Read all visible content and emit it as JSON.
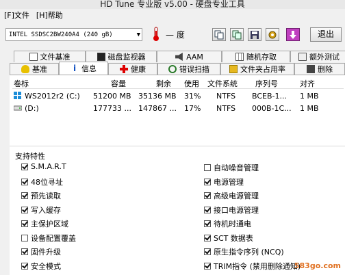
{
  "window": {
    "title": "HD Tune 专业版 v5.00 - 硬盘专业工具"
  },
  "menu": {
    "file": "[F]文件",
    "help": "[H]帮助"
  },
  "toolbar": {
    "drive": "INTEL SSDSC2BW240A4 (240 gB)",
    "temperature": "— 度",
    "exit_label": "退出"
  },
  "tabs_row1": [
    {
      "label": "文件基准"
    },
    {
      "label": "磁盘监视器"
    },
    {
      "label": "AAM"
    },
    {
      "label": "随机存取"
    },
    {
      "label": "额外测试"
    }
  ],
  "tabs_row2": [
    {
      "label": "基准"
    },
    {
      "label": "信息"
    },
    {
      "label": "健康"
    },
    {
      "label": "错误扫描"
    },
    {
      "label": "文件夹占用率"
    },
    {
      "label": "删除"
    }
  ],
  "table": {
    "headers": {
      "volume": "卷标",
      "capacity": "容量",
      "free": "剩余",
      "usage": "使用",
      "fs": "文件系统",
      "serial": "序列号",
      "align": "对齐"
    },
    "rows": [
      {
        "volume": "WS2012r2 (C:)",
        "capacity": "51200 MB",
        "free": "35136 MB",
        "usage": "31%",
        "fs": "NTFS",
        "serial": "BCEB-1...",
        "align": "1 MB"
      },
      {
        "volume": "(D:)",
        "capacity": "177733 ...",
        "free": "147867 ...",
        "usage": "17%",
        "fs": "NTFS",
        "serial": "000B-1C...",
        "align": "1 MB"
      }
    ]
  },
  "features": {
    "title": "支持特性",
    "left": [
      {
        "label": "S.M.A.R.T",
        "checked": true
      },
      {
        "label": "48位寻址",
        "checked": true
      },
      {
        "label": "预先读取",
        "checked": true
      },
      {
        "label": "写入缓存",
        "checked": true
      },
      {
        "label": "主保护区域",
        "checked": true
      },
      {
        "label": "设备配置覆盖",
        "checked": false
      },
      {
        "label": "固件升级",
        "checked": true
      },
      {
        "label": "安全模式",
        "checked": true
      }
    ],
    "right": [
      {
        "label": "自动噪音管理",
        "checked": false
      },
      {
        "label": "电源管理",
        "checked": true
      },
      {
        "label": "高级电源管理",
        "checked": true
      },
      {
        "label": "接口电源管理",
        "checked": true
      },
      {
        "label": "待机时通电",
        "checked": true
      },
      {
        "label": "SCT 数据表",
        "checked": true
      },
      {
        "label": "原生指令序列 (NCQ)",
        "checked": true
      },
      {
        "label": "TRIM指令 (禁用删除通知)",
        "checked": true
      }
    ]
  },
  "watermark": "583go.com"
}
